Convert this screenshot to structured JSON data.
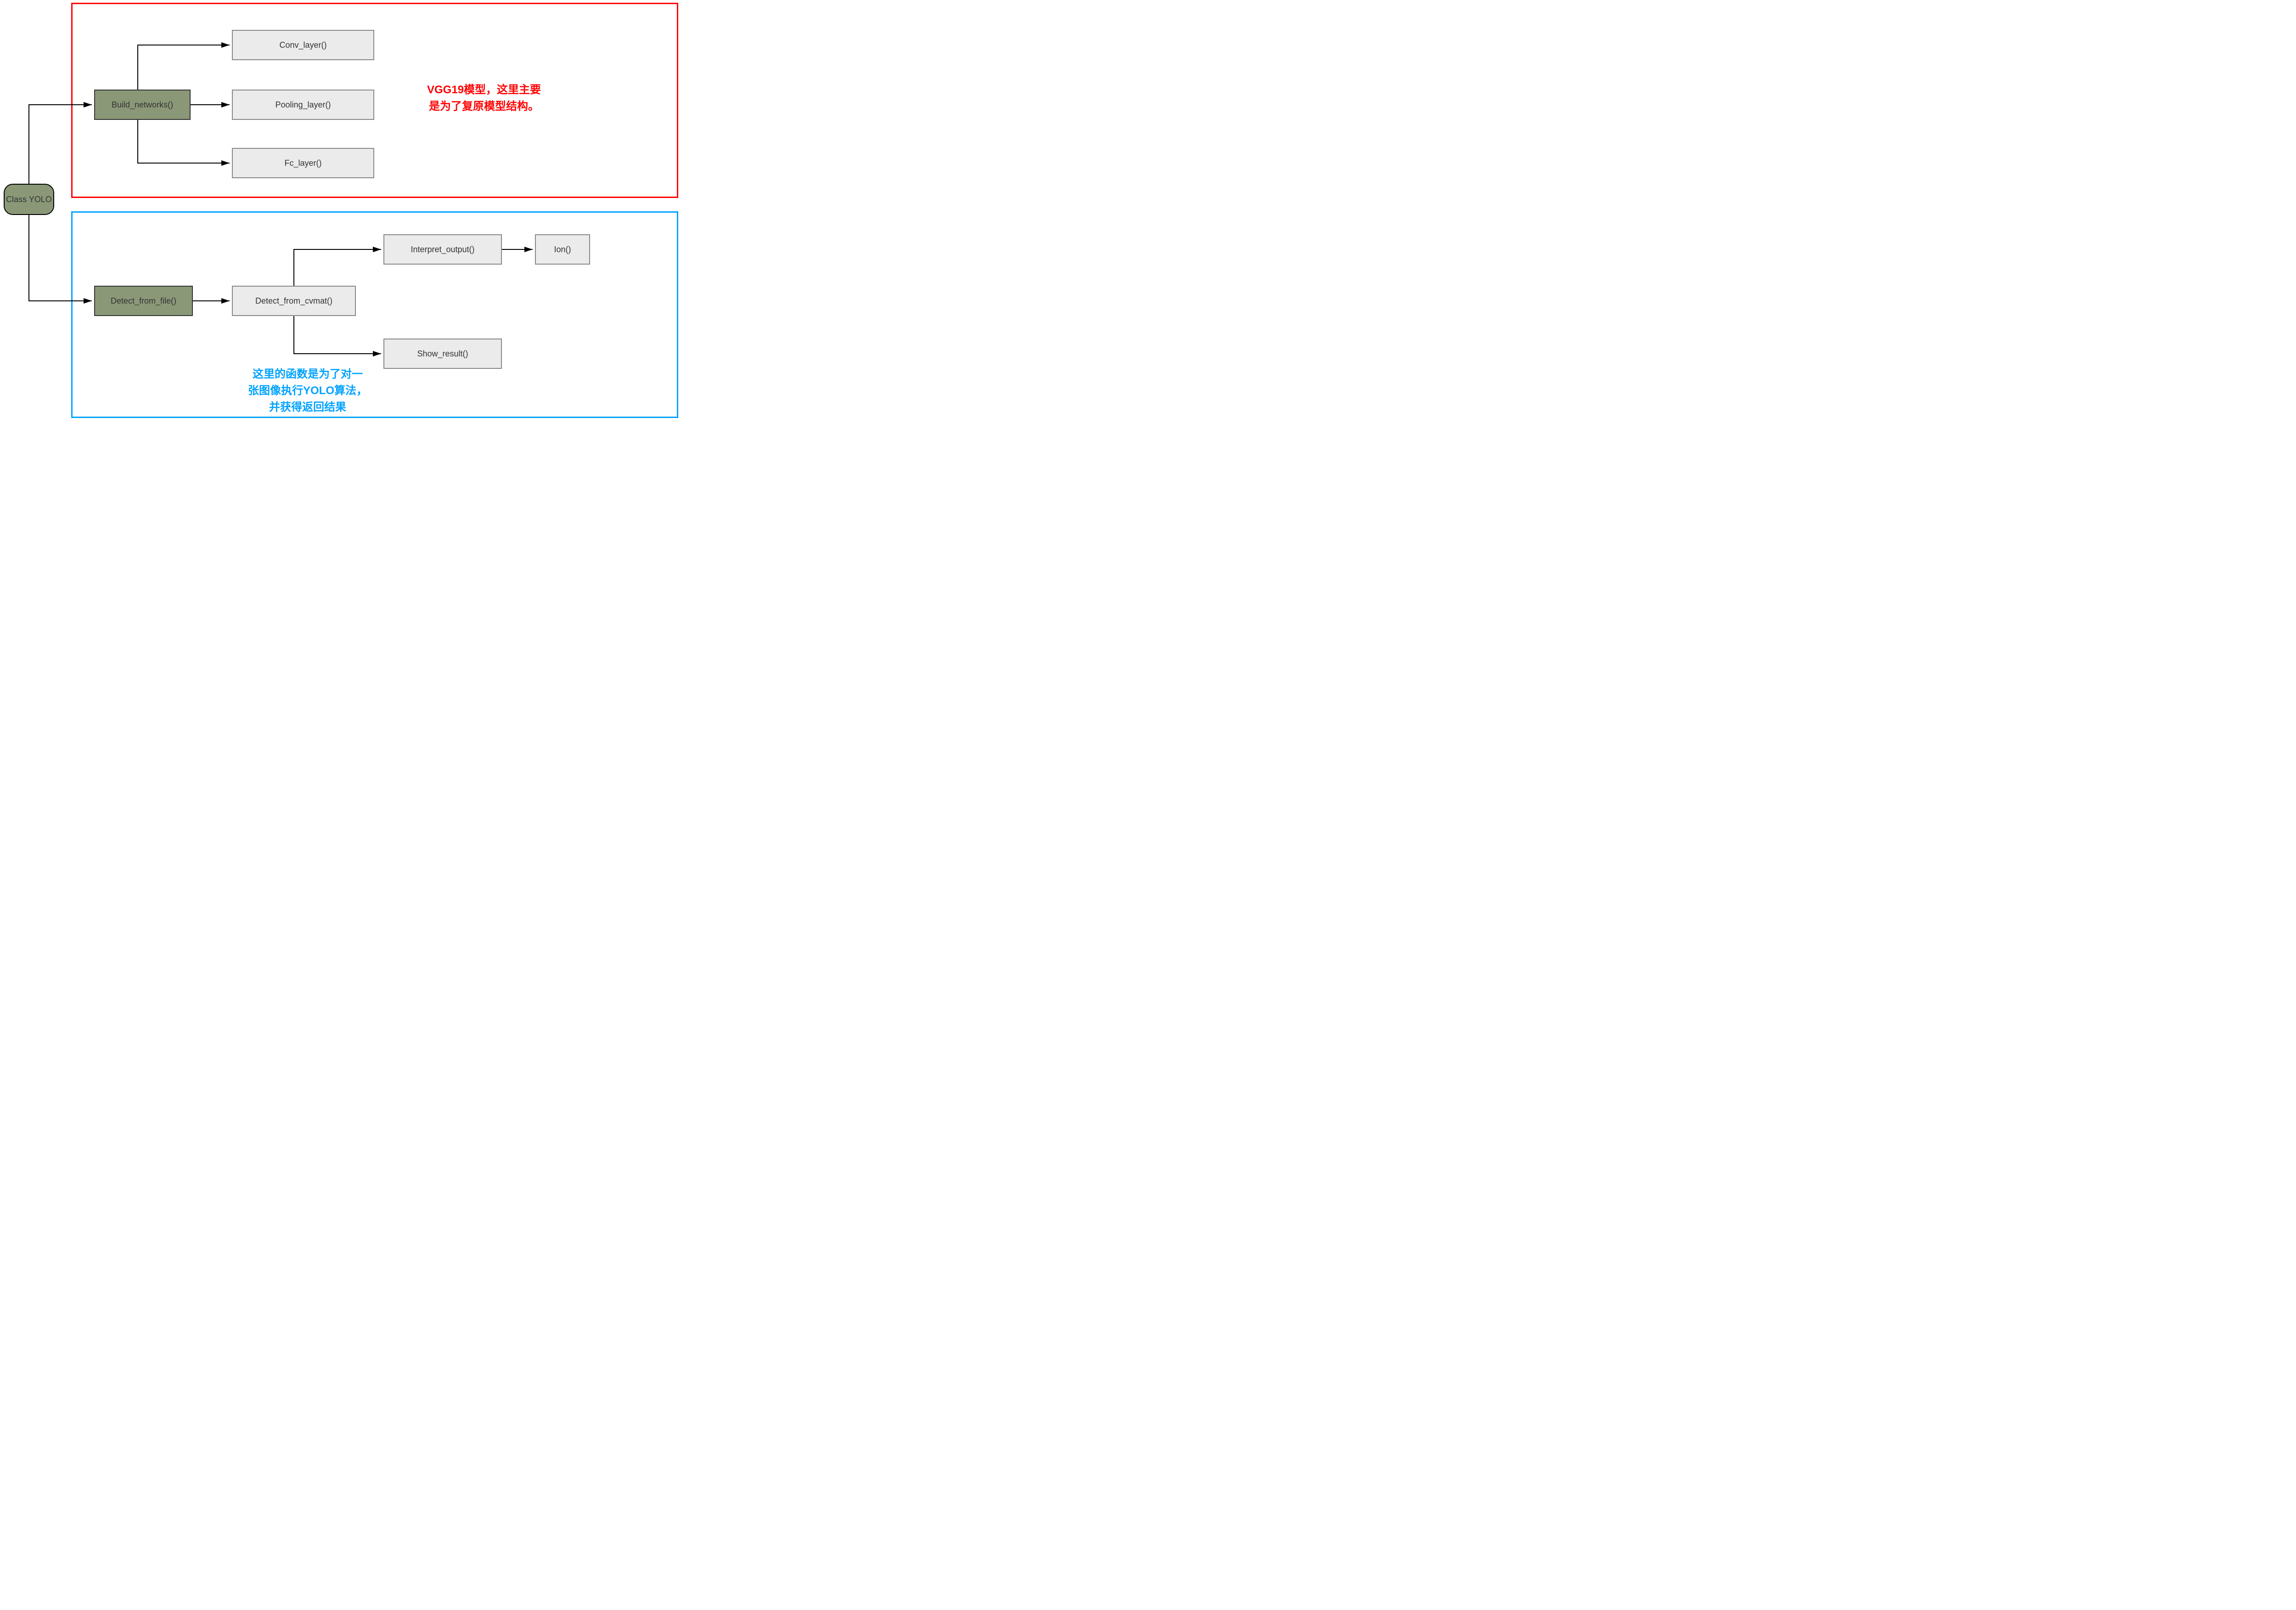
{
  "nodes": {
    "root": "Class YOLO",
    "build_networks": "Build_networks()",
    "conv_layer": "Conv_layer()",
    "pooling_layer": "Pooling_layer()",
    "fc_layer": "Fc_layer()",
    "detect_from_file": "Detect_from_file()",
    "detect_from_cvmat": "Detect_from_cvmat()",
    "interpret_output": "Interpret_output()",
    "ion": "Ion()",
    "show_result": "Show_result()"
  },
  "annotations": {
    "red_line1": "VGG19模型，这里主要",
    "red_line2": "是为了复原模型结构。",
    "blue_line1": "这里的函数是为了对一",
    "blue_line2": "张图像执行YOLO算法，",
    "blue_line3": "并获得返回结果"
  },
  "colors": {
    "red": "#ff0000",
    "blue": "#00a2ff",
    "green_node": "#8b9878",
    "grey_node": "#ebebeb"
  }
}
